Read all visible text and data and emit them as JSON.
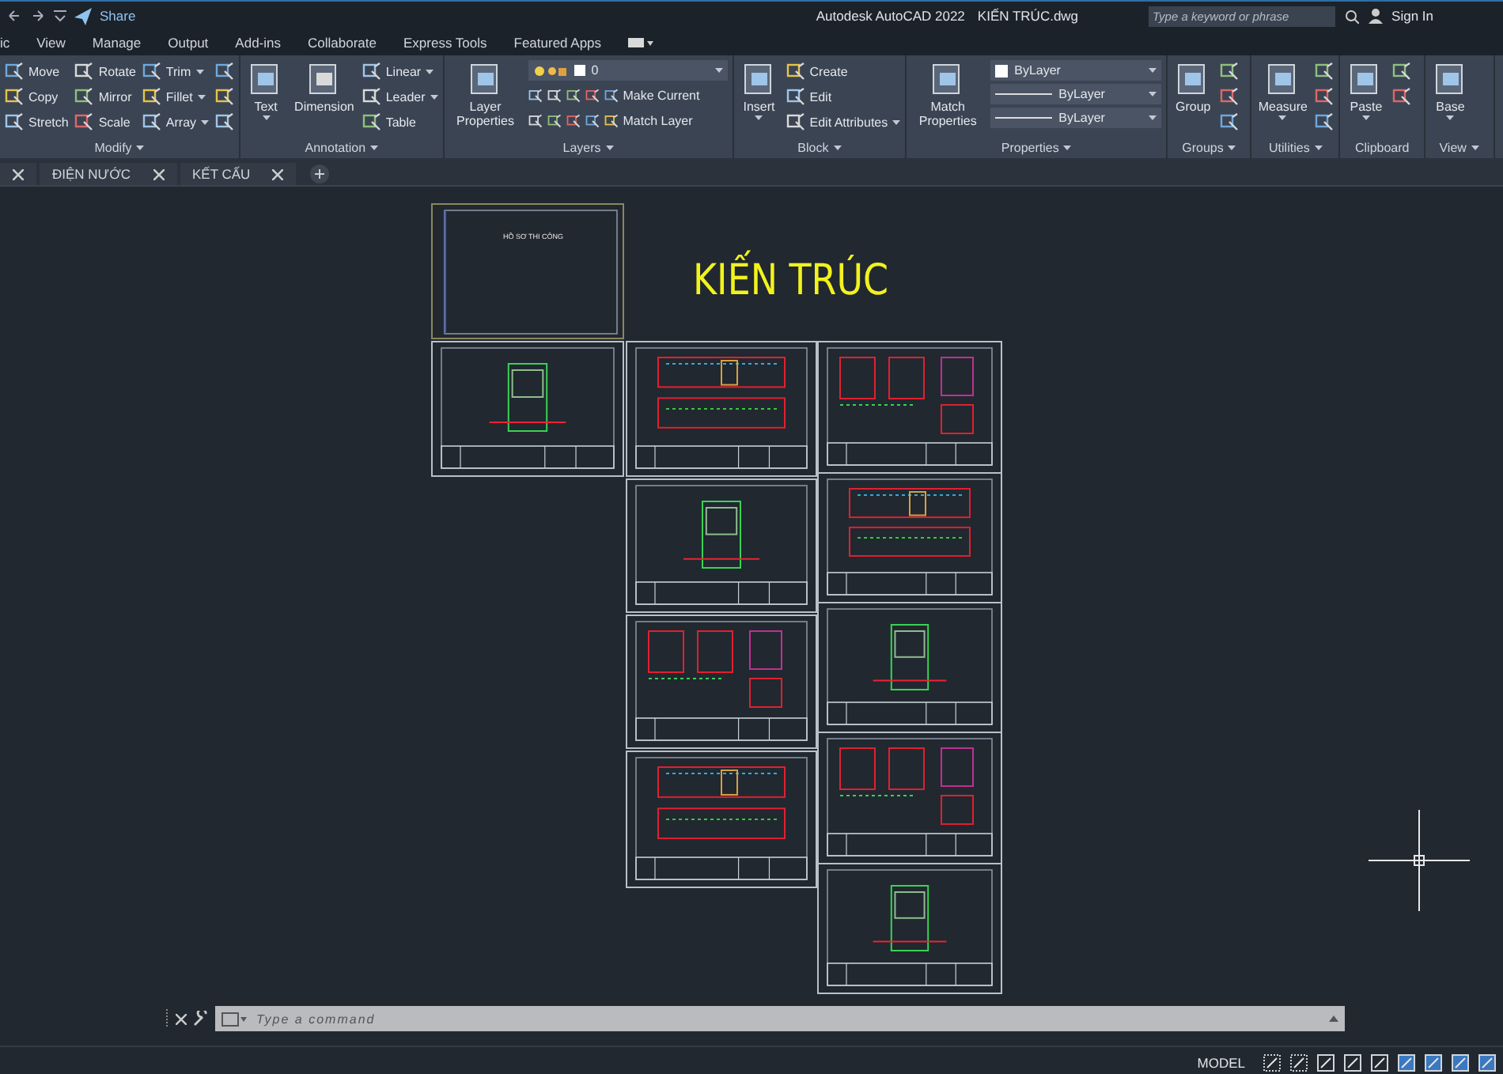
{
  "title_bar": {
    "share": "Share",
    "app_title": "Autodesk AutoCAD 2022",
    "file_name": "KIẾN TRÚC.dwg",
    "search": {
      "placeholder": "Type a keyword or phrase"
    },
    "sign_in": "Sign In"
  },
  "ribbon_tabs": [
    {
      "label": "ic"
    },
    {
      "label": "View"
    },
    {
      "label": "Manage"
    },
    {
      "label": "Output"
    },
    {
      "label": "Add-ins"
    },
    {
      "label": "Collaborate"
    },
    {
      "label": "Express Tools"
    },
    {
      "label": "Featured Apps"
    }
  ],
  "ribbon_panels": [
    {
      "label": "Modify",
      "dropdown": true,
      "tools": [
        {
          "kind": "small",
          "label": "Move"
        },
        {
          "kind": "small",
          "label": "Copy"
        },
        {
          "kind": "small",
          "label": "Stretch"
        },
        {
          "kind": "small",
          "label": "Rotate"
        },
        {
          "kind": "small",
          "label": "Mirror"
        },
        {
          "kind": "small",
          "label": "Scale"
        },
        {
          "kind": "small",
          "label": "Trim",
          "dropdown": true
        },
        {
          "kind": "small",
          "label": "Fillet",
          "dropdown": true
        },
        {
          "kind": "small",
          "label": "Array",
          "dropdown": true
        },
        {
          "kind": "icon"
        },
        {
          "kind": "icon"
        },
        {
          "kind": "icon"
        }
      ]
    },
    {
      "label": "Annotation",
      "dropdown": true,
      "tools": [
        {
          "kind": "large",
          "label": "Text",
          "dropdown": true
        },
        {
          "kind": "large",
          "label": "Dimension"
        },
        {
          "kind": "small",
          "label": "Linear",
          "dropdown": true
        },
        {
          "kind": "small",
          "label": "Leader",
          "dropdown": true
        },
        {
          "kind": "small",
          "label": "Table"
        }
      ]
    },
    {
      "label": "Layers",
      "dropdown": true,
      "tools": [
        {
          "kind": "large",
          "label": "Layer Properties"
        },
        {
          "kind": "layer-combo",
          "label": "0"
        },
        {
          "kind": "layer-tool",
          "label": "Make Current"
        },
        {
          "kind": "layer-tool",
          "label": "Match Layer"
        }
      ]
    },
    {
      "label": "Block",
      "dropdown": true,
      "tools": [
        {
          "kind": "large",
          "label": "Insert",
          "dropdown": true
        },
        {
          "kind": "small",
          "label": "Create"
        },
        {
          "kind": "small",
          "label": "Edit"
        },
        {
          "kind": "small",
          "label": "Edit Attributes",
          "dropdown": true
        }
      ]
    },
    {
      "label": "Properties",
      "dropdown": true,
      "tools": [
        {
          "kind": "large",
          "label": "Match Properties"
        },
        {
          "kind": "color-combo",
          "label": "ByLayer"
        },
        {
          "kind": "line-combo",
          "label": "ByLayer"
        },
        {
          "kind": "line-combo",
          "label": "ByLayer"
        }
      ]
    },
    {
      "label": "Groups",
      "dropdown": true,
      "tools": [
        {
          "kind": "large",
          "label": "Group"
        },
        {
          "kind": "icon"
        },
        {
          "kind": "icon"
        },
        {
          "kind": "icon"
        }
      ]
    },
    {
      "label": "Utilities",
      "dropdown": true,
      "tools": [
        {
          "kind": "large",
          "label": "Measure",
          "dropdown": true
        },
        {
          "kind": "icon"
        },
        {
          "kind": "icon"
        },
        {
          "kind": "icon"
        }
      ]
    },
    {
      "label": "Clipboard",
      "dropdown": false,
      "tools": [
        {
          "kind": "large",
          "label": "Paste",
          "dropdown": true
        },
        {
          "kind": "icon"
        },
        {
          "kind": "icon"
        }
      ]
    },
    {
      "label": "View",
      "dropdown": true,
      "tools": [
        {
          "kind": "large",
          "label": "Base",
          "dropdown": true
        }
      ]
    }
  ],
  "document_tabs": [
    {
      "label": "ĐIỆN NƯỚC"
    },
    {
      "label": "KẾT CẤU"
    }
  ],
  "canvas": {
    "title": "KIẾN TRÚC",
    "cover_sheet_text": "HỒ SƠ THI CÔNG"
  },
  "command_line": {
    "placeholder": "Type a command"
  },
  "status_bar": {
    "space": "MODEL"
  }
}
